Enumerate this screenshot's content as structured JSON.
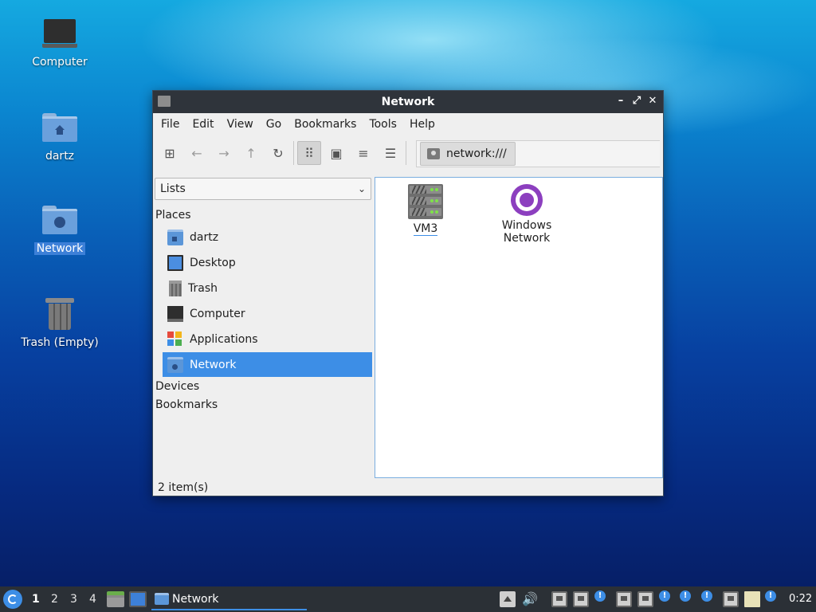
{
  "desktop": {
    "icons": [
      {
        "label": "Computer"
      },
      {
        "label": "dartz"
      },
      {
        "label": "Network"
      },
      {
        "label": "Trash (Empty)"
      }
    ]
  },
  "window": {
    "title": "Network",
    "controls": {
      "minimize": "–",
      "maximize": "⤢",
      "close": "✕"
    },
    "menu": [
      "File",
      "Edit",
      "View",
      "Go",
      "Bookmarks",
      "Tools",
      "Help"
    ],
    "toolbar": {
      "buttons": [
        {
          "icon": "new-tab-icon",
          "glyph": "⊞"
        },
        {
          "icon": "back-icon",
          "glyph": "←"
        },
        {
          "icon": "forward-icon",
          "glyph": "→"
        },
        {
          "icon": "up-icon",
          "glyph": "↑"
        },
        {
          "icon": "reload-icon",
          "glyph": "↻"
        }
      ],
      "views": [
        {
          "icon": "icon-view-icon",
          "glyph": "⠿",
          "active": true
        },
        {
          "icon": "thumbnail-view-icon",
          "glyph": "▣"
        },
        {
          "icon": "compact-view-icon",
          "glyph": "≡"
        },
        {
          "icon": "detailed-list-view-icon",
          "glyph": "☰"
        }
      ],
      "path": "network:///"
    },
    "sidebar": {
      "mode": "Lists",
      "places_header": "Places",
      "places": [
        {
          "label": "dartz",
          "icon": "home-folder-icon"
        },
        {
          "label": "Desktop",
          "icon": "desktop-icon"
        },
        {
          "label": "Trash",
          "icon": "trash-icon"
        },
        {
          "label": "Computer",
          "icon": "computer-icon"
        },
        {
          "label": "Applications",
          "icon": "applications-icon"
        },
        {
          "label": "Network",
          "icon": "network-folder-icon",
          "active": true
        }
      ],
      "devices_header": "Devices",
      "bookmarks_header": "Bookmarks"
    },
    "files": [
      {
        "label": "VM3",
        "icon": "server-icon"
      },
      {
        "label_line1": "Windows",
        "label_line2": "Network",
        "icon": "windows-network-icon"
      }
    ],
    "status": "2 item(s)"
  },
  "taskbar": {
    "workspaces": [
      "1",
      "2",
      "3",
      "4"
    ],
    "current_workspace": "1",
    "task_label": "Network",
    "volume_glyph": "🔊",
    "alert_glyph": "!",
    "clock": "0:22"
  },
  "colors": {
    "accent": "#3d8ee6",
    "titlebar": "#2f343b",
    "taskbar": "#2b3036"
  }
}
